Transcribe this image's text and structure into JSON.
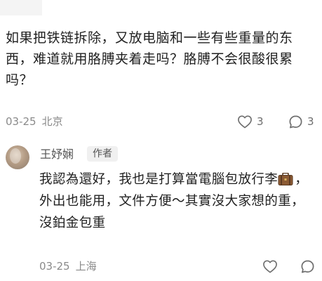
{
  "comment": {
    "text": "如果把铁链拆除，又放电脑和一些有些重量的东西，难道就用胳膊夹着走吗？胳膊不会很酸很累吗？",
    "date": "03-25",
    "location": "北京",
    "likes": "3",
    "replies": "3"
  },
  "reply": {
    "avatar_icon": "user-avatar",
    "name": "王妤娴",
    "badge": "作者",
    "text_part1": "我認為還好，我也是打算當電腦包放行李",
    "emoji_icon": "suitcase-icon",
    "text_part2": "，外出也能用，文件方便～其實沒大家想的重，沒鉑金包重",
    "date": "03-25",
    "location": "上海"
  },
  "colors": {
    "text": "#1f1f1f",
    "meta": "#8a8a8a",
    "icon": "#6e6e6e",
    "badge_bg": "#f0f0f0"
  }
}
